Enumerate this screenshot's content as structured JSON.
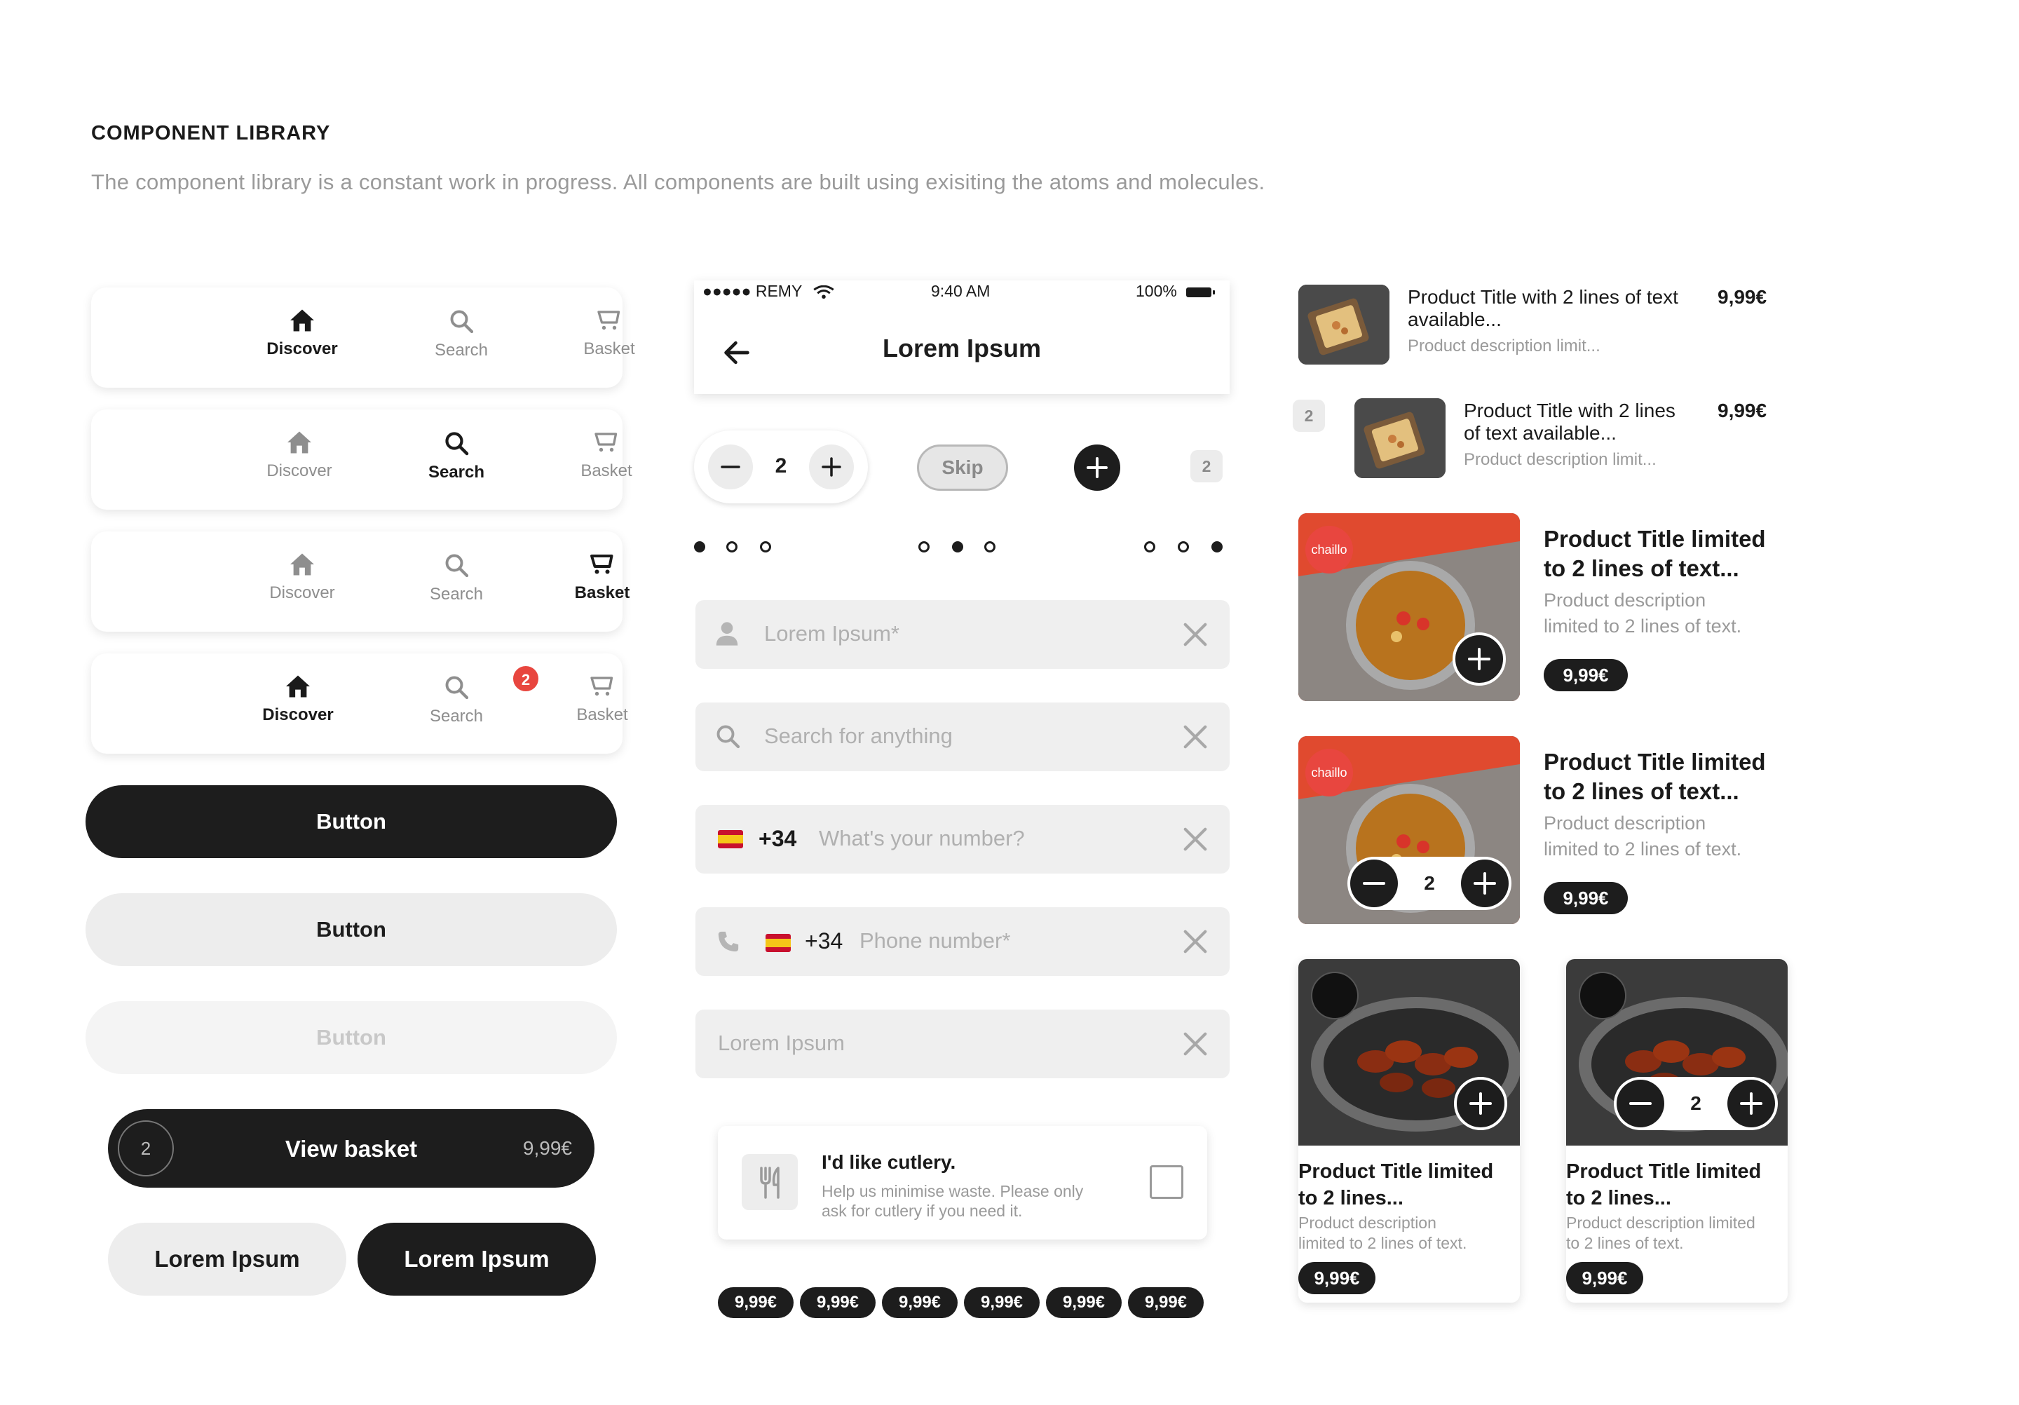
{
  "header": {
    "title": "COMPONENT LIBRARY",
    "subtitle": "The component library is a constant work in progress. All components are built using exisiting the atoms and molecules."
  },
  "tabbars": [
    {
      "tabs": [
        {
          "label": "Discover",
          "icon": "home-icon",
          "active": true
        },
        {
          "label": "Search",
          "icon": "search-icon",
          "active": false
        },
        {
          "label": "Basket",
          "icon": "basket-icon",
          "active": false
        }
      ]
    },
    {
      "tabs": [
        {
          "label": "Discover",
          "icon": "home-icon",
          "active": false
        },
        {
          "label": "Search",
          "icon": "search-icon",
          "active": true
        },
        {
          "label": "Basket",
          "icon": "basket-icon",
          "active": false
        }
      ]
    },
    {
      "tabs": [
        {
          "label": "Discover",
          "icon": "home-icon",
          "active": false
        },
        {
          "label": "Search",
          "icon": "search-icon",
          "active": false
        },
        {
          "label": "Basket",
          "icon": "basket-icon",
          "active": true
        }
      ]
    },
    {
      "tabs": [
        {
          "label": "Discover",
          "icon": "home-icon",
          "active": true
        },
        {
          "label": "Search",
          "icon": "search-icon",
          "active": false
        },
        {
          "label": "Basket",
          "icon": "basket-icon",
          "active": false
        }
      ],
      "basket_badge": "2"
    }
  ],
  "buttons": {
    "primary": "Button",
    "secondary": "Button",
    "disabled": "Button",
    "view_basket": {
      "count": "2",
      "label": "View basket",
      "price": "9,99€"
    },
    "pair_left": "Lorem Ipsum",
    "pair_right": "Lorem Ipsum"
  },
  "phone": {
    "carrier": "●●●●● REMY",
    "time": "9:40 AM",
    "battery": "100%",
    "title": "Lorem Ipsum"
  },
  "controls": {
    "stepper_value": "2",
    "skip_label": "Skip",
    "count_badge": "2"
  },
  "pagination": [
    [
      true,
      false,
      false
    ],
    [
      false,
      true,
      false
    ],
    [
      false,
      false,
      true
    ]
  ],
  "fields": {
    "name": {
      "placeholder": "Lorem Ipsum*"
    },
    "search": {
      "placeholder": "Search for anything"
    },
    "phone1": {
      "prefix": "+34",
      "placeholder": "What's your number?"
    },
    "phone2": {
      "prefix": "+34",
      "placeholder": "Phone number*"
    },
    "plain": {
      "placeholder": "Lorem Ipsum"
    }
  },
  "cutlery": {
    "title": "I'd like cutlery.",
    "desc_line1": "Help us minimise waste. Please only",
    "desc_line2": "ask for cutlery if you need it."
  },
  "price_chips": [
    "9,99€",
    "9,99€",
    "9,99€",
    "9,99€",
    "9,99€",
    "9,99€"
  ],
  "products": {
    "row1": {
      "title_l1": "Product Title with 2 lines of text",
      "title_l2": "available...",
      "desc": "Product description limit...",
      "price": "9,99€"
    },
    "row2": {
      "qty": "2",
      "title_l1": "Product Title with 2 lines",
      "title_l2": "of text available...",
      "desc": "Product description limit...",
      "price": "9,99€"
    },
    "wide1": {
      "logo": "chaillo",
      "title_l1": "Product Title limited",
      "title_l2": "to 2 lines of text...",
      "desc_l1": "Product description",
      "desc_l2": "limited to 2 lines of text.",
      "price": "9,99€"
    },
    "wide2": {
      "logo": "chaillo",
      "qty": "2",
      "title_l1": "Product Title limited",
      "title_l2": "to 2 lines of text...",
      "desc_l1": "Product description",
      "desc_l2": "limited to 2 lines of text.",
      "price": "9,99€"
    },
    "card1": {
      "title_l1": "Product Title limited",
      "title_l2": "to 2 lines...",
      "desc_l1": "Product description",
      "desc_l2": "limited to 2 lines of text.",
      "price": "9,99€"
    },
    "card2": {
      "qty": "2",
      "title_l1": "Product Title limited",
      "title_l2": "to 2 lines...",
      "desc_l1": "Product description limited",
      "desc_l2": "to 2 lines of text.",
      "price": "9,99€"
    }
  },
  "colors": {
    "dark": "#1d1d1d",
    "badge_red": "#e8463f",
    "field_bg": "#efefef",
    "muted": "#9a9a9a"
  }
}
